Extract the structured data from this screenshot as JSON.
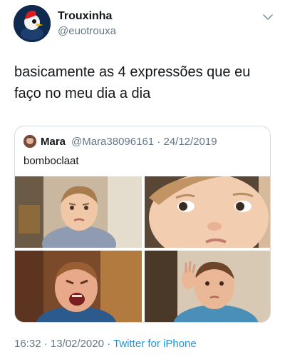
{
  "author": {
    "display_name": "Trouxinha",
    "handle": "@euotrouxa"
  },
  "tweet_text": "basicamente as 4 expressões que eu faço no meu dia a dia",
  "quoted_tweet": {
    "display_name": "Mara",
    "handle_and_date": "@Mara38096161 · 24/12/2019",
    "text": "bomboclaat",
    "media_count": 4
  },
  "footer": {
    "timestamp": "16:32 · 13/02/2020 · ",
    "source": "Twitter for iPhone"
  },
  "colors": {
    "text": "#14171a",
    "secondary": "#657786",
    "link": "#1b95e0",
    "border": "#d4dbe0"
  },
  "icons": [
    "chevron-down-icon"
  ]
}
